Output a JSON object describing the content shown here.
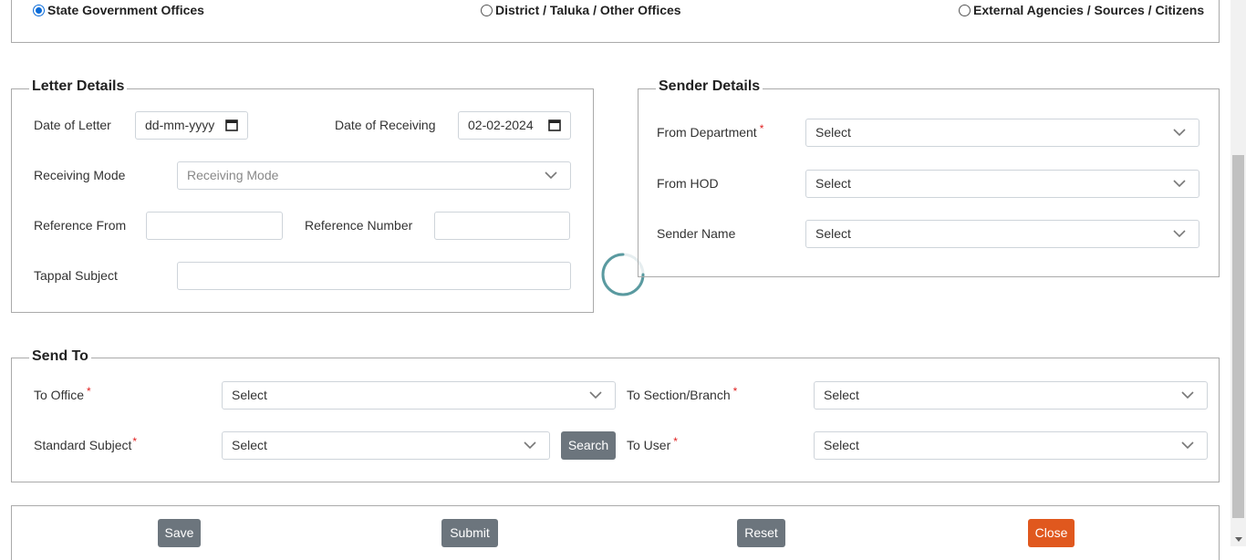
{
  "office_type": {
    "options": [
      {
        "label": "State Government Offices",
        "checked": true
      },
      {
        "label": "District / Taluka / Other Offices",
        "checked": false
      },
      {
        "label": "External Agencies / Sources / Citizens",
        "checked": false
      }
    ]
  },
  "letter_details": {
    "legend": "Letter Details",
    "date_of_letter_label": "Date of Letter",
    "date_of_letter_value": "dd-mm-yyyy",
    "date_of_receiving_label": "Date of Receiving",
    "date_of_receiving_value": "02-02-2024",
    "receiving_mode_label": "Receiving Mode",
    "receiving_mode_placeholder": "Receiving Mode",
    "reference_from_label": "Reference From",
    "reference_from_value": "",
    "reference_number_label": "Reference Number",
    "reference_number_value": "",
    "tappal_subject_label": "Tappal Subject",
    "tappal_subject_value": ""
  },
  "sender_details": {
    "legend": "Sender Details",
    "from_department_label": "From Department",
    "from_department_value": "Select",
    "from_hod_label": "From HOD",
    "from_hod_value": "Select",
    "sender_name_label": "Sender Name",
    "sender_name_value": "Select"
  },
  "send_to": {
    "legend": "Send To",
    "to_office_label": "To Office",
    "to_office_value": "Select",
    "to_section_label": "To Section/Branch",
    "to_section_value": "Select",
    "standard_subject_label": "Standard Subject",
    "standard_subject_value": "Select",
    "search_label": "Search",
    "to_user_label": "To User",
    "to_user_value": "Select"
  },
  "required_mark": "*",
  "actions": {
    "save": "Save",
    "submit": "Submit",
    "reset": "Reset",
    "close": "Close"
  },
  "colors": {
    "primary_radio": "#0b6bd8",
    "button_secondary": "#6c757d",
    "button_close": "#e0581e",
    "spinner": "#5a9aa0"
  },
  "icons": {
    "dropdown": "chevron-down-icon",
    "calendar": "calendar-icon",
    "loading": "spinner-icon"
  }
}
